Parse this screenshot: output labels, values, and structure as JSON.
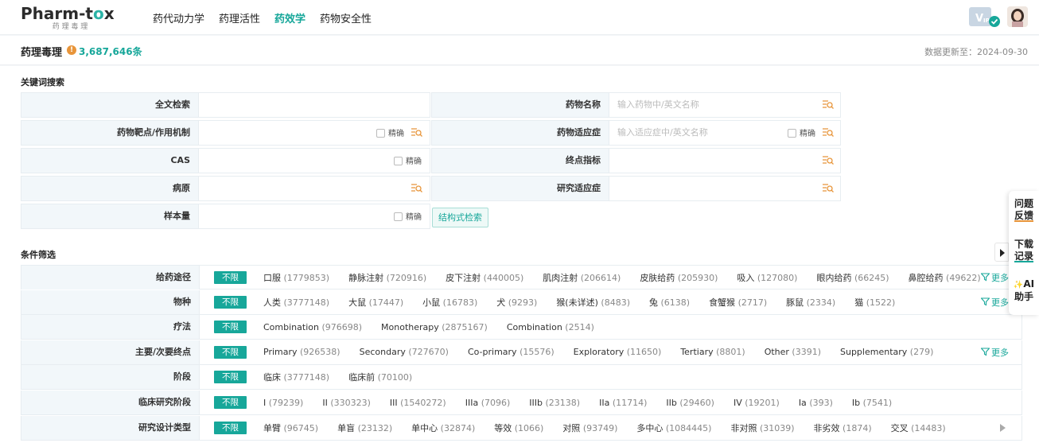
{
  "brand": {
    "name_prefix": "Pharm-t",
    "name_o": "o",
    "name_suffix": "x",
    "subtitle": "药 理 毒 理"
  },
  "nav": [
    "药代动力学",
    "药理活性",
    "药效学",
    "药物安全性"
  ],
  "nav_active": 2,
  "header": {
    "title": "药理毒理",
    "info_glyph": "!",
    "count": "3,687,646条",
    "updated": "数据更新至：2024-09-30"
  },
  "keyword_section": {
    "title": "关键词搜索",
    "precise_label": "精确",
    "struct_button": "结构式检索"
  },
  "fields": {
    "fulltext": {
      "label": "全文检索",
      "placeholder": ""
    },
    "drug_name": {
      "label": "药物名称",
      "placeholder": "输入药物中/英文名称"
    },
    "target": {
      "label": "药物靶点/作用机制",
      "placeholder": ""
    },
    "indication": {
      "label": "药物适应症",
      "placeholder": "输入适应症中/英文名称"
    },
    "cas": {
      "label": "CAS",
      "placeholder": ""
    },
    "endpoint": {
      "label": "终点指标",
      "placeholder": ""
    },
    "pathogen": {
      "label": "病原",
      "placeholder": ""
    },
    "research_indication": {
      "label": "研究适应症",
      "placeholder": ""
    },
    "sample_size": {
      "label": "样本量",
      "placeholder": ""
    }
  },
  "filter_section": {
    "title": "条件筛选",
    "all_label": "不限",
    "more_label": "更多"
  },
  "filters": [
    {
      "label": "给药途径",
      "more": true,
      "options": [
        {
          "name": "口服",
          "count": "(1779853)"
        },
        {
          "name": "静脉注射",
          "count": "(720916)"
        },
        {
          "name": "皮下注射",
          "count": "(440005)"
        },
        {
          "name": "肌肉注射",
          "count": "(206614)"
        },
        {
          "name": "皮肤给药",
          "count": "(205930)"
        },
        {
          "name": "吸入",
          "count": "(127080)"
        },
        {
          "name": "眼内给药",
          "count": "(66245)"
        },
        {
          "name": "鼻腔给药",
          "count": "(49622)"
        }
      ]
    },
    {
      "label": "物种",
      "more": true,
      "options": [
        {
          "name": "人类",
          "count": "(3777148)"
        },
        {
          "name": "大鼠",
          "count": "(17447)"
        },
        {
          "name": "小鼠",
          "count": "(16783)"
        },
        {
          "name": "犬",
          "count": "(9293)"
        },
        {
          "name": "猴(未详述)",
          "count": "(8483)"
        },
        {
          "name": "兔",
          "count": "(6138)"
        },
        {
          "name": "食蟹猴",
          "count": "(2717)"
        },
        {
          "name": "豚鼠",
          "count": "(2334)"
        },
        {
          "name": "猫",
          "count": "(1522)"
        }
      ]
    },
    {
      "label": "疗法",
      "more": false,
      "options": [
        {
          "name": "Combination",
          "count": "(976698)"
        },
        {
          "name": "Monotherapy",
          "count": "(2875167)"
        },
        {
          "name": "Combination",
          "count": "(2514)"
        }
      ]
    },
    {
      "label": "主要/次要终点",
      "more": true,
      "options": [
        {
          "name": "Primary",
          "count": "(926538)"
        },
        {
          "name": "Secondary",
          "count": "(727670)"
        },
        {
          "name": "Co-primary",
          "count": "(15576)"
        },
        {
          "name": "Exploratory",
          "count": "(11650)"
        },
        {
          "name": "Tertiary",
          "count": "(8801)"
        },
        {
          "name": "Other",
          "count": "(3391)"
        },
        {
          "name": "Supplementary",
          "count": "(279)"
        }
      ]
    },
    {
      "label": "阶段",
      "more": false,
      "options": [
        {
          "name": "临床",
          "count": "(3777148)"
        },
        {
          "name": "临床前",
          "count": "(70100)"
        }
      ]
    },
    {
      "label": "临床研究阶段",
      "more": false,
      "options": [
        {
          "name": "I",
          "count": "(79239)"
        },
        {
          "name": "II",
          "count": "(330323)"
        },
        {
          "name": "III",
          "count": "(1540272)"
        },
        {
          "name": "IIIa",
          "count": "(7096)"
        },
        {
          "name": "IIIb",
          "count": "(23138)"
        },
        {
          "name": "IIa",
          "count": "(11714)"
        },
        {
          "name": "IIb",
          "count": "(29460)"
        },
        {
          "name": "IV",
          "count": "(19201)"
        },
        {
          "name": "Ia",
          "count": "(393)"
        },
        {
          "name": "Ib",
          "count": "(7541)"
        }
      ]
    },
    {
      "label": "研究设计类型",
      "more": false,
      "arrow": true,
      "options": [
        {
          "name": "单臂",
          "count": "(96745)"
        },
        {
          "name": "单盲",
          "count": "(23132)"
        },
        {
          "name": "单中心",
          "count": "(32874)"
        },
        {
          "name": "等效",
          "count": "(1066)"
        },
        {
          "name": "对照",
          "count": "(93749)"
        },
        {
          "name": "多中心",
          "count": "(1084445)"
        },
        {
          "name": "非对照",
          "count": "(31039)"
        },
        {
          "name": "非劣效",
          "count": "(1874)"
        },
        {
          "name": "交叉",
          "count": "(14483)"
        }
      ]
    }
  ],
  "side_panel": {
    "feedback": [
      "问题",
      "反馈"
    ],
    "download": [
      "下载",
      "记录"
    ],
    "ai": [
      "AI",
      "助手"
    ],
    "ai_glyph": "✨"
  },
  "colors": {
    "accent": "#17a79a",
    "orange": "#e8953a",
    "label_bg": "#f2f7fa"
  },
  "icons": [
    "search-list-icon",
    "filter-icon",
    "info-icon",
    "vip-icon",
    "avatar",
    "chevron-right-icon"
  ]
}
